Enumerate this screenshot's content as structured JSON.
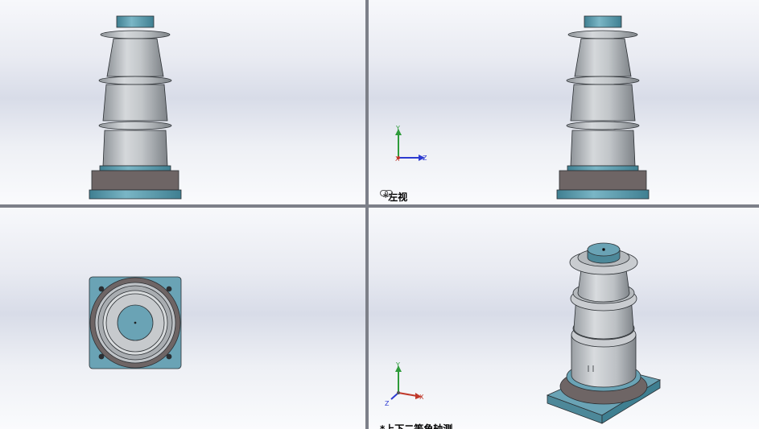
{
  "viewports": {
    "top_left": {
      "label": ""
    },
    "top_right": {
      "label": "*左视"
    },
    "bottom_left": {
      "label": ""
    },
    "bottom_right": {
      "label": "*上下二等角轴测"
    }
  },
  "triad": {
    "x": "X",
    "y": "Y",
    "z": "Z"
  },
  "colors": {
    "body_gray": "#bfc3c7",
    "cap_teal": "#5f9fb0",
    "base_dark": "#6e6565",
    "plate_teal": "#6aa3b5",
    "divider": "#6b7280"
  },
  "icons": [
    "link-icon",
    "view-triad-icon"
  ]
}
